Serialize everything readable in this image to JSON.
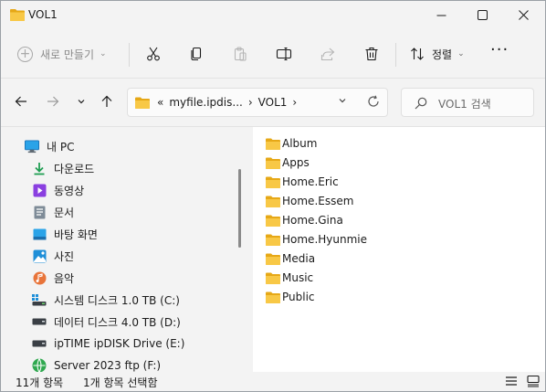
{
  "window": {
    "title": "VOL1",
    "icons": {
      "folder": "folder-icon",
      "minimize": "minimize-icon",
      "maximize": "maximize-icon",
      "close": "close-icon"
    }
  },
  "commandbar": {
    "new_label": "새로 만들기",
    "sort_label": "정렬",
    "tools": [
      "cut-icon",
      "copy-icon",
      "paste-icon",
      "rename-icon",
      "share-icon",
      "delete-icon"
    ]
  },
  "address": {
    "crumbs": [
      "«",
      "myfile.ipdis...",
      "›",
      "VOL1",
      "›"
    ]
  },
  "search": {
    "placeholder": "VOL1 검색"
  },
  "sidebar": {
    "items": [
      {
        "label": "내 PC",
        "icon": "pc-icon"
      },
      {
        "label": "다운로드",
        "icon": "download-icon"
      },
      {
        "label": "동영상",
        "icon": "video-icon"
      },
      {
        "label": "문서",
        "icon": "document-icon"
      },
      {
        "label": "바탕 화면",
        "icon": "desktop-icon"
      },
      {
        "label": "사진",
        "icon": "pictures-icon"
      },
      {
        "label": "음악",
        "icon": "music-icon"
      },
      {
        "label": "시스템 디스크 1.0 TB (C:)",
        "icon": "system-drive-icon"
      },
      {
        "label": "데이터 디스크 4.0 TB (D:)",
        "icon": "drive-icon"
      },
      {
        "label": "ipTIME ipDISK Drive (E:)",
        "icon": "network-drive-icon"
      },
      {
        "label": "Server 2023 ftp (F:)",
        "icon": "ftp-drive-icon"
      }
    ]
  },
  "files": [
    {
      "name": "Album"
    },
    {
      "name": "Apps"
    },
    {
      "name": "Home.Eric"
    },
    {
      "name": "Home.Essem"
    },
    {
      "name": "Home.Gina"
    },
    {
      "name": "Home.Hyunmie"
    },
    {
      "name": "Media"
    },
    {
      "name": "Music"
    },
    {
      "name": "Public"
    }
  ],
  "status": {
    "item_count": "11개 항목",
    "selection": "1개 항목 선택함"
  },
  "colors": {
    "folder": "#f5c242",
    "folder_dark": "#e6a817",
    "accent": "#0067c0"
  }
}
